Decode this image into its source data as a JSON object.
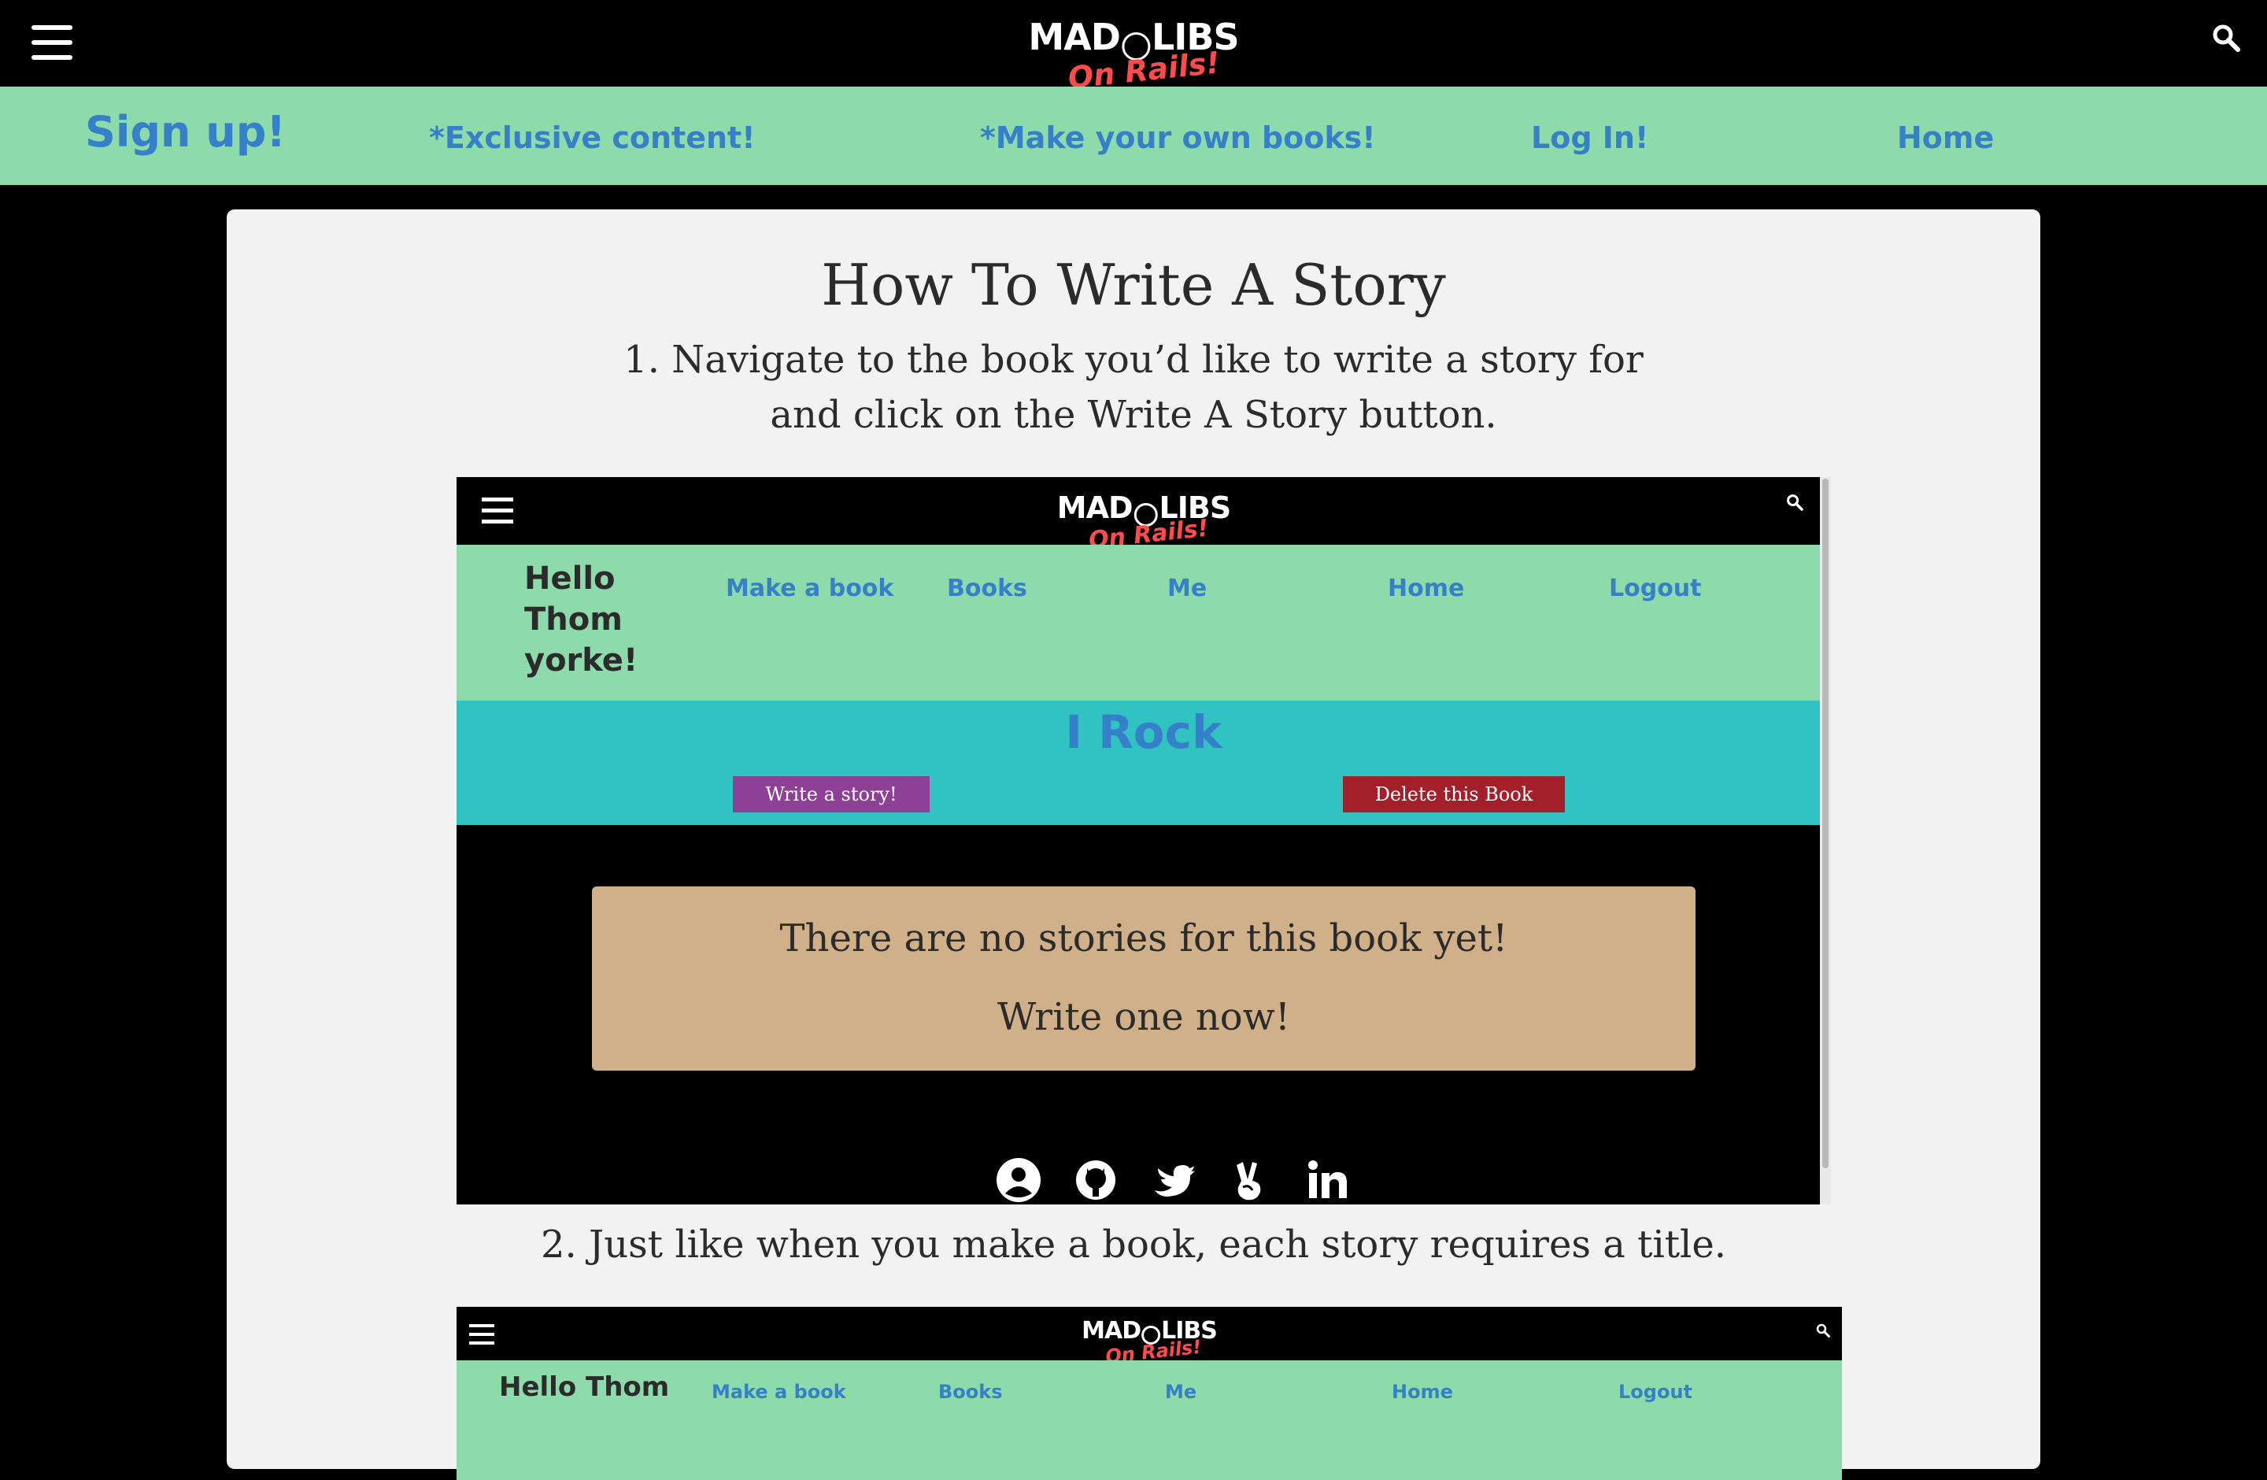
{
  "header": {
    "logo_top": "MAD",
    "logo_top_right": "LIBS",
    "logo_bottom": "On Rails!"
  },
  "nav": {
    "signup": "Sign up!",
    "exclusive": "*Exclusive content!",
    "make_books": "*Make your own books!",
    "login": "Log In!",
    "home": "Home"
  },
  "main": {
    "title": "How To Write A Story",
    "step1_line1": "1. Navigate to the book you’d like to write a story for",
    "step1_line2": "and click on the Write A Story button.",
    "step2": "2. Just like when you make a book, each story requires a title."
  },
  "screenshot1": {
    "logo_top": "MAD",
    "logo_top_right": "LIBS",
    "logo_bottom": "On Rails!",
    "hello_line1": "Hello",
    "hello_line2": "Thom",
    "hello_line3": "yorke!",
    "nav_make_book": "Make a book",
    "nav_books": "Books",
    "nav_me": "Me",
    "nav_home": "Home",
    "nav_logout": "Logout",
    "book_title": "I Rock",
    "write_button": "Write a story!",
    "delete_button": "Delete this Book",
    "notice_line1": "There are no stories for this book yet!",
    "notice_line2": "Write one now!",
    "footer_icons": [
      "user-circle-icon",
      "github-icon",
      "twitter-icon",
      "angellist-icon",
      "linkedin-icon"
    ]
  },
  "screenshot2": {
    "logo_top": "MAD",
    "logo_top_right": "LIBS",
    "logo_bottom": "On Rails!",
    "hello": "Hello Thom",
    "nav_make_book": "Make a book",
    "nav_books": "Books",
    "nav_me": "Me",
    "nav_home": "Home",
    "nav_logout": "Logout"
  },
  "colors": {
    "nav_bg": "#8ddbab",
    "link": "#3580c8",
    "book_bg": "#31c3c2",
    "write_btn": "#8e3f96",
    "delete_btn": "#a31f2a",
    "notice_bg": "#cfb088",
    "logo_accent": "#ff4b4b"
  }
}
